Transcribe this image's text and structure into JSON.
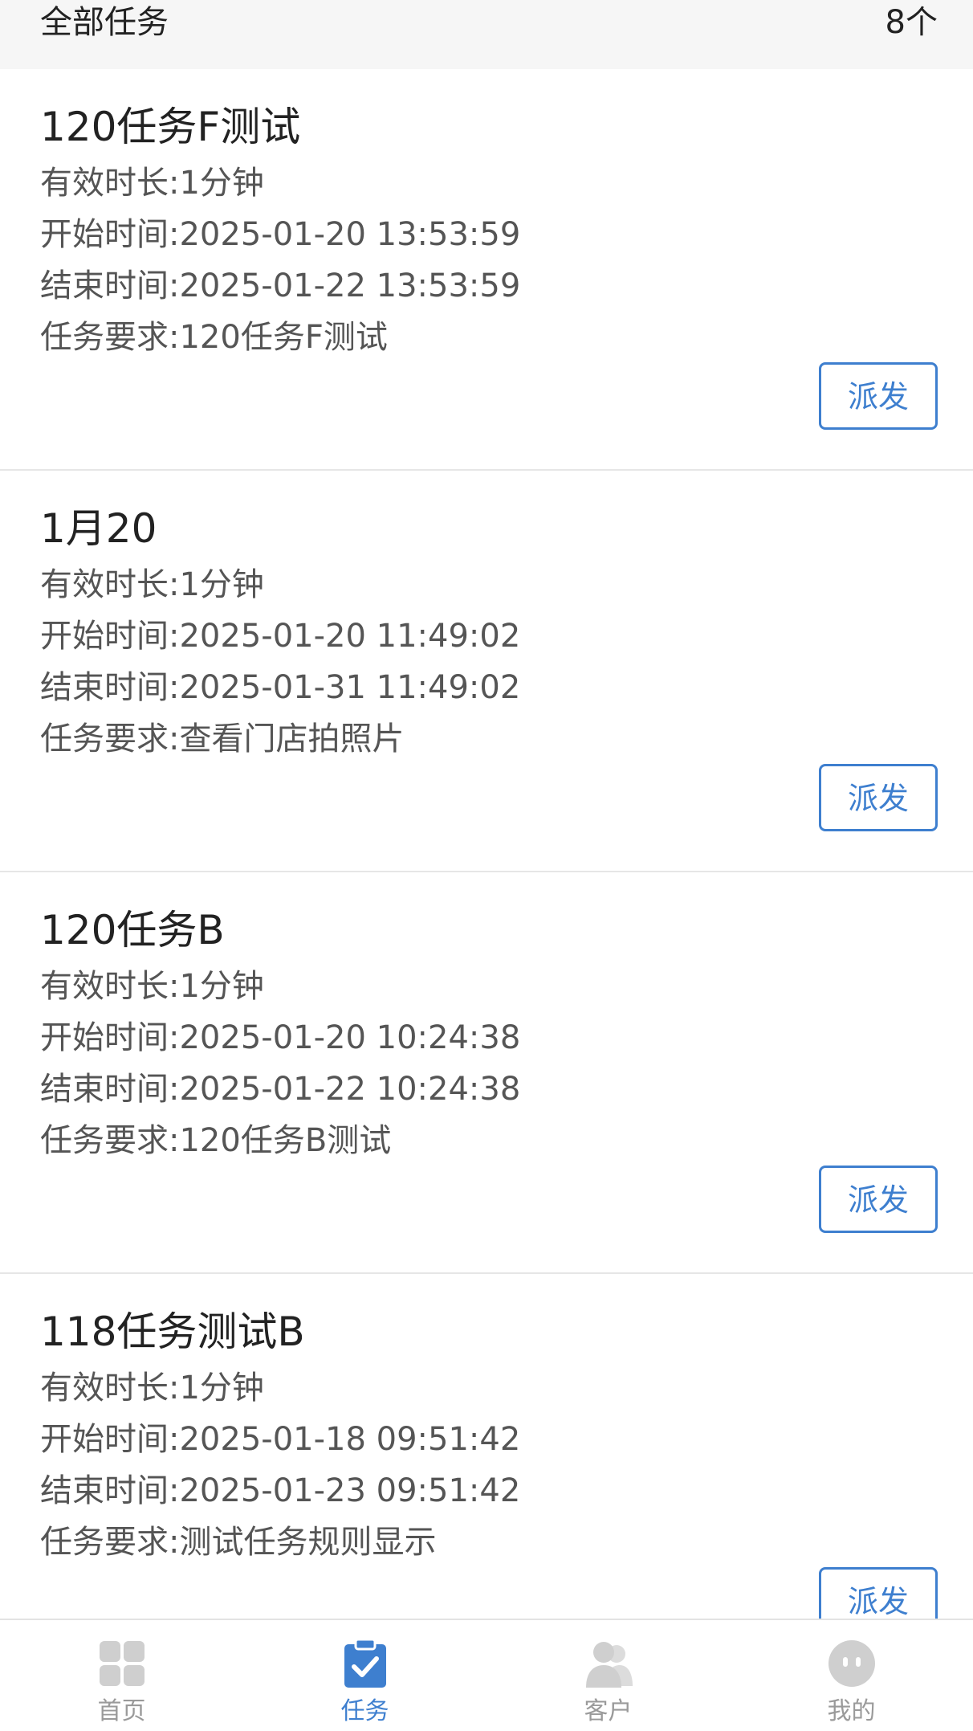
{
  "header": {
    "title": "全部任务",
    "count": "8个"
  },
  "tasks": [
    {
      "title": "120任务F测试",
      "duration": "有效时长:1分钟",
      "start": "开始时间:2025-01-20 13:53:59",
      "end": "结束时间:2025-01-22 13:53:59",
      "requirement": "任务要求:120任务F测试",
      "button": "派发"
    },
    {
      "title": "1月20",
      "duration": "有效时长:1分钟",
      "start": "开始时间:2025-01-20 11:49:02",
      "end": "结束时间:2025-01-31 11:49:02",
      "requirement": "任务要求:查看门店拍照片",
      "button": "派发"
    },
    {
      "title": "120任务B",
      "duration": "有效时长:1分钟",
      "start": "开始时间:2025-01-20 10:24:38",
      "end": "结束时间:2025-01-22 10:24:38",
      "requirement": "任务要求:120任务B测试",
      "button": "派发"
    },
    {
      "title": "118任务测试B",
      "duration": "有效时长:1分钟",
      "start": "开始时间:2025-01-18 09:51:42",
      "end": "结束时间:2025-01-23 09:51:42",
      "requirement": "任务要求:测试任务规则显示",
      "button": "派发"
    }
  ],
  "tabbar": {
    "items": [
      {
        "label": "首页",
        "icon": "home-grid-icon",
        "active": false
      },
      {
        "label": "任务",
        "icon": "task-clipboard-icon",
        "active": true
      },
      {
        "label": "客户",
        "icon": "customer-people-icon",
        "active": false
      },
      {
        "label": "我的",
        "icon": "profile-face-icon",
        "active": false
      }
    ],
    "active_color": "#3e7fcf",
    "inactive_color": "#cfcfcf"
  },
  "colors": {
    "accent": "#3e7fcf",
    "header_bg": "#f6f6f6"
  }
}
